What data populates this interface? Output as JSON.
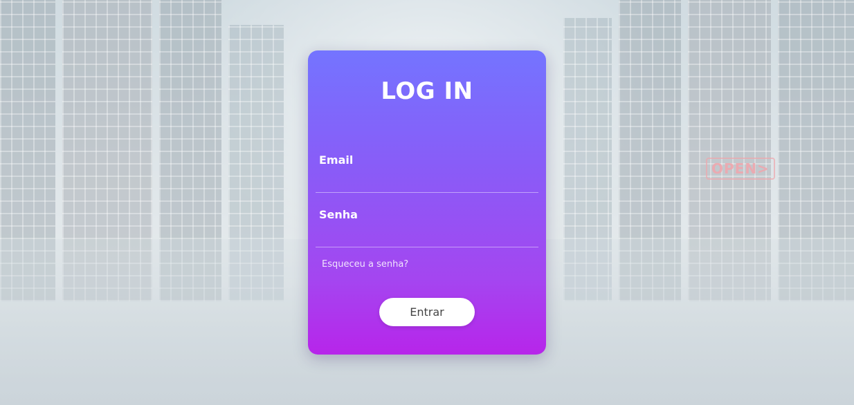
{
  "login": {
    "title": "LOG IN",
    "email": {
      "label": "Email",
      "value": "",
      "placeholder": ""
    },
    "password": {
      "label": "Senha",
      "value": "",
      "placeholder": ""
    },
    "forgot_link": "Esqueceu a senha?",
    "submit_label": "Entrar"
  },
  "background": {
    "neon_sign": "OPEN>"
  },
  "colors": {
    "card_gradient_top": "#7474ff",
    "card_gradient_bottom": "#b725ea",
    "text": "#ffffff",
    "button_bg": "#ffffff",
    "button_text": "#444444"
  }
}
